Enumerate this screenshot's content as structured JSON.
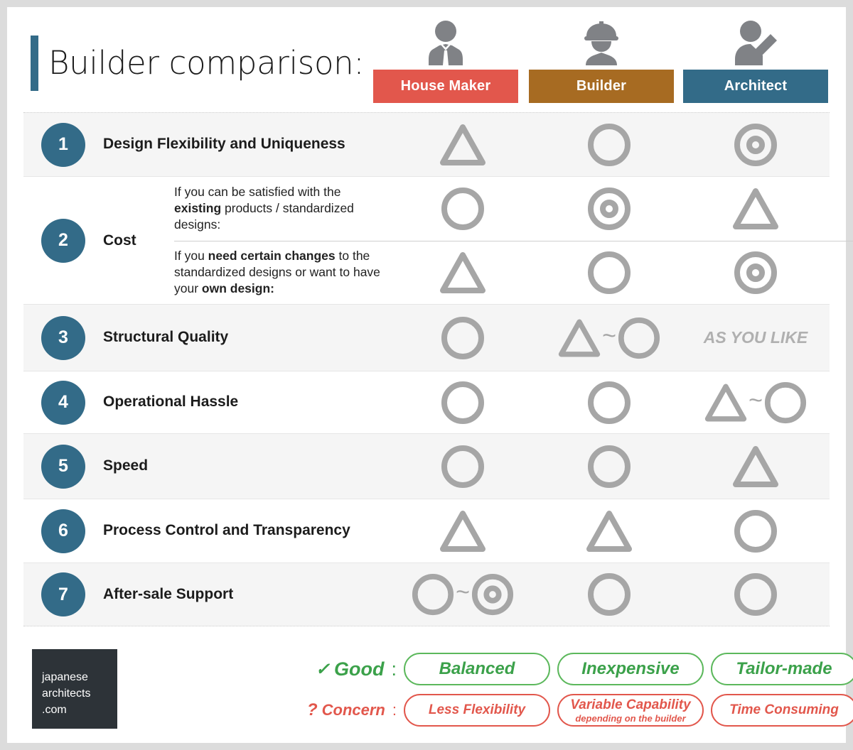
{
  "header": {
    "title": "Builder comparison:",
    "columns": [
      {
        "label": "House Maker",
        "color": "#e2574c",
        "icon": "businessman-icon"
      },
      {
        "label": "Builder",
        "color": "#a76b22",
        "icon": "construction-worker-icon"
      },
      {
        "label": "Architect",
        "color": "#336b88",
        "icon": "architect-pencil-icon"
      }
    ]
  },
  "rows": [
    {
      "number": "1",
      "label": "Design Flexibility and Uniqueness",
      "marks": [
        "triangle",
        "circle",
        "double-circle"
      ]
    },
    {
      "number": "2",
      "label": "Cost",
      "sub": [
        {
          "desc_parts": [
            {
              "text": "If you can be satisfied with the ",
              "bold": false
            },
            {
              "text": "existing",
              "bold": true
            },
            {
              "text": " products / standardized designs:",
              "bold": false
            }
          ],
          "marks": [
            "circle",
            "double-circle",
            "triangle"
          ]
        },
        {
          "desc_parts": [
            {
              "text": "If you ",
              "bold": false
            },
            {
              "text": "need certain changes",
              "bold": true
            },
            {
              "text": " to the standardized designs or want to have your ",
              "bold": false
            },
            {
              "text": "own design:",
              "bold": true
            }
          ],
          "marks": [
            "triangle",
            "circle",
            "double-circle"
          ]
        }
      ]
    },
    {
      "number": "3",
      "label": "Structural Quality",
      "marks": [
        "circle",
        "triangle~circle",
        "as-you-like"
      ],
      "as_you_like_text": "AS YOU LIKE"
    },
    {
      "number": "4",
      "label": "Operational Hassle",
      "marks": [
        "circle",
        "circle",
        "triangle~circle"
      ]
    },
    {
      "number": "5",
      "label": "Speed",
      "marks": [
        "circle",
        "circle",
        "triangle"
      ]
    },
    {
      "number": "6",
      "label": "Process Control and Transparency",
      "marks": [
        "triangle",
        "triangle",
        "circle"
      ]
    },
    {
      "number": "7",
      "label": "After-sale Support",
      "marks": [
        "circle~double-circle",
        "circle",
        "circle"
      ]
    }
  ],
  "footer": {
    "logo": {
      "line1": "japanese",
      "line2": "architects",
      "line3": ".com"
    },
    "legend": {
      "good": {
        "mark": "✓",
        "label": "Good",
        "colon": ":",
        "items": [
          {
            "main": "Balanced",
            "sub": ""
          },
          {
            "main": "Inexpensive",
            "sub": ""
          },
          {
            "main": "Tailor-made",
            "sub": ""
          }
        ]
      },
      "concern": {
        "mark": "?",
        "label": "Concern",
        "colon": ":",
        "items": [
          {
            "main": "Less Flexibility",
            "sub": ""
          },
          {
            "main": "Variable Capability",
            "sub": "depending on the builder"
          },
          {
            "main": "Time Consuming",
            "sub": ""
          }
        ]
      }
    }
  },
  "colors": {
    "accent_blue": "#336b88",
    "house_maker": "#e2574c",
    "builder": "#a76b22",
    "architect": "#336b88",
    "symbol_gray": "#a6a6a6",
    "good_green": "#5cb85c",
    "concern_red": "#e2574c",
    "row_shade": "#f5f5f5"
  }
}
